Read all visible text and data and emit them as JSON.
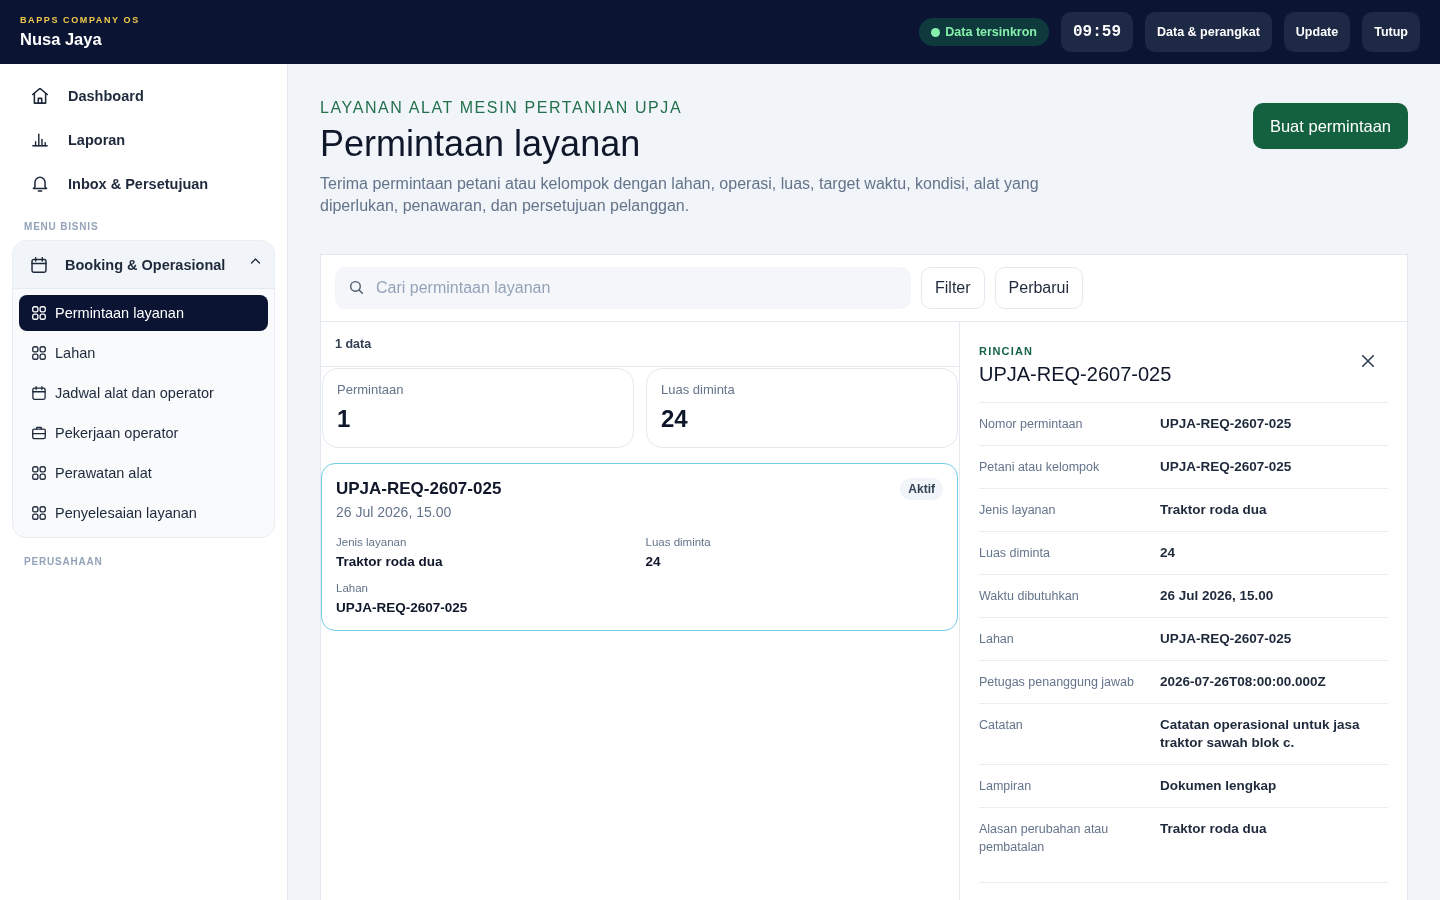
{
  "topbar": {
    "eyebrow": "BAPPS COMPANY OS",
    "title": "Nusa Jaya",
    "status": {
      "label": "Data tersinkron",
      "synced": true
    },
    "clock": "09:59",
    "buttons": [
      "Data & perangkat",
      "Update",
      "Tutup"
    ]
  },
  "sidebar": {
    "items": [
      {
        "label": "Dashboard",
        "selected": false
      },
      {
        "label": "Laporan",
        "selected": false
      },
      {
        "label": "Inbox & Persetujuan",
        "selected": false
      }
    ],
    "sections": [
      {
        "label": "MENU BISNIS",
        "groups": [
          {
            "label": "Booking & Operasional",
            "expanded": true,
            "items": [
              {
                "label": "Permintaan layanan",
                "selected": true
              },
              {
                "label": "Lahan",
                "selected": false
              },
              {
                "label": "Jadwal alat dan operator",
                "selected": false
              },
              {
                "label": "Pekerjaan operator",
                "selected": false
              },
              {
                "label": "Perawatan alat",
                "selected": false
              },
              {
                "label": "Penyelesaian layanan",
                "selected": false
              }
            ]
          }
        ]
      },
      {
        "label": "PERUSAHAAN"
      }
    ]
  },
  "header": {
    "eyebrow": "LAYANAN ALAT MESIN PERTANIAN UPJA",
    "title": "Permintaan layanan",
    "description": "Terima permintaan petani atau kelompok dengan lahan, operasi, luas, target waktu, kondisi, alat yang diperlukan, penawaran, dan persetujuan pelanggan.",
    "action": "Buat permintaan"
  },
  "list": {
    "search": {
      "placeholder": "Cari permintaan layanan"
    },
    "buttons": [
      "Filter",
      "Perbarui"
    ],
    "count": "1 data",
    "stats": [
      {
        "label": "Permintaan",
        "value": "1"
      },
      {
        "label": "Luas diminta",
        "value": "24"
      }
    ],
    "requests": [
      {
        "id": "UPJA-REQ-2607-025",
        "date": "26 Jul 2026, 15.00",
        "badge": "Aktif",
        "selected": true,
        "fields": [
          {
            "label": "Jenis layanan",
            "value": "Traktor roda dua"
          },
          {
            "label": "Luas diminta",
            "value": "24"
          },
          {
            "label": "Lahan",
            "value": "UPJA-REQ-2607-025"
          }
        ]
      }
    ]
  },
  "detail": {
    "eyebrow": "RINCIAN",
    "title": "UPJA-REQ-2607-025",
    "rows": [
      {
        "label": "Nomor permintaan",
        "value": "UPJA-REQ-2607-025"
      },
      {
        "label": "Petani atau kelompok",
        "value": "UPJA-REQ-2607-025"
      },
      {
        "label": "Jenis layanan",
        "value": "Traktor roda dua"
      },
      {
        "label": "Luas diminta",
        "value": "24"
      },
      {
        "label": "Waktu dibutuhkan",
        "value": "26 Jul 2026, 15.00"
      },
      {
        "label": "Lahan",
        "value": "UPJA-REQ-2607-025"
      },
      {
        "label": "Petugas penanggung jawab",
        "value": "2026-07-26T08:00:00.000Z"
      },
      {
        "label": "Catatan",
        "value": "Catatan operasional untuk jasa traktor sawah blok c."
      },
      {
        "label": "Lampiran",
        "value": "Dokumen lengkap"
      },
      {
        "label": "Alasan perubahan atau pembatalan",
        "value": "Traktor roda dua"
      }
    ]
  }
}
